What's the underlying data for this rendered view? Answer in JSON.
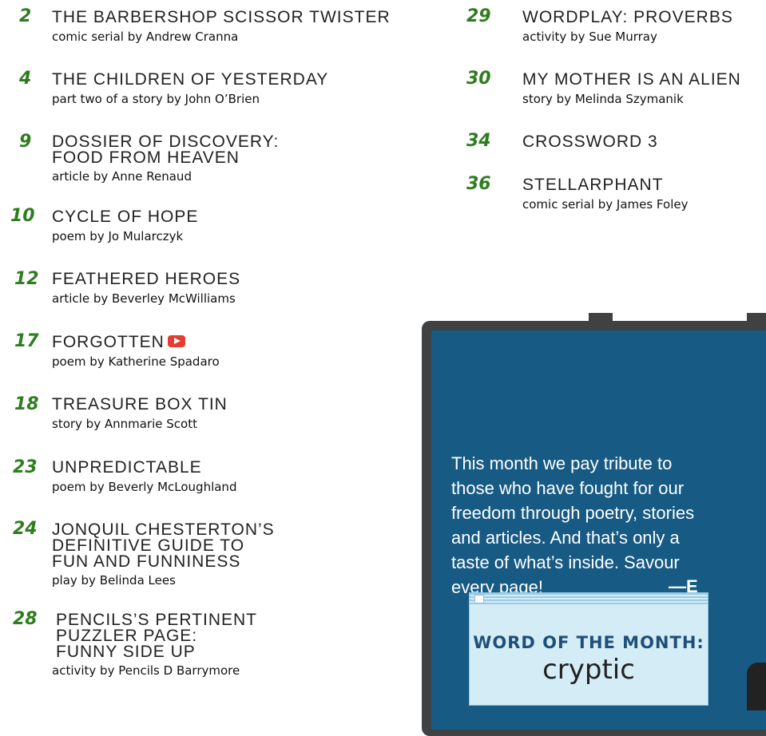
{
  "contents": [
    {
      "page": "2",
      "title": [
        "THE BARBERSHOP SCISSOR TWISTER"
      ],
      "byline": "comic serial by Andrew Cranna"
    },
    {
      "page": "4",
      "title": [
        "THE CHILDREN OF YESTERDAY"
      ],
      "byline": "part two of a story by John O’Brien"
    },
    {
      "page": "9",
      "title": [
        "DOSSIER OF DISCOVERY:",
        "FOOD FROM HEAVEN"
      ],
      "byline": "article by Anne Renaud"
    },
    {
      "page": "10",
      "title": [
        "CYCLE OF HOPE"
      ],
      "byline": "poem by Jo Mularczyk"
    },
    {
      "page": "12",
      "title": [
        "FEATHERED HEROES"
      ],
      "byline": "article by Beverley McWilliams"
    },
    {
      "page": "17",
      "title": [
        "FORGOTTEN"
      ],
      "byline": "poem by Katherine Spadaro",
      "icon": "youtube-play-icon"
    },
    {
      "page": "18",
      "title": [
        "TREASURE BOX TIN"
      ],
      "byline": "story by Annmarie Scott"
    },
    {
      "page": "23",
      "title": [
        "UNPREDICTABLE"
      ],
      "byline": "poem by Beverly McLoughland"
    },
    {
      "page": "24",
      "title": [
        "JONQUIL CHESTERTON’S",
        "DEFINITIVE GUIDE TO",
        "FUN AND FUNNINESS"
      ],
      "byline": "play by Belinda Lees"
    },
    {
      "page": "28",
      "title": [
        "PENCILS’S PERTINENT",
        "PUZZLER PAGE:",
        "FUNNY SIDE UP"
      ],
      "byline": "activity by Pencils D Barrymore"
    },
    {
      "page": "29",
      "title": [
        "WORDPLAY: PROVERBS"
      ],
      "byline": "activity by Sue Murray"
    },
    {
      "page": "30",
      "title": [
        "MY MOTHER IS AN ALIEN"
      ],
      "byline": "story by Melinda Szymanik"
    },
    {
      "page": "34",
      "title": [
        "CROSSWORD 3"
      ],
      "byline": ""
    },
    {
      "page": "36",
      "title": [
        "STELLARPHANT"
      ],
      "byline": "comic serial by James Foley"
    }
  ],
  "editorial": {
    "lines": [
      "This month we pay tribute to",
      "those who have fought for our",
      "freedom through poetry, stories",
      "and articles. And that’s only a",
      "taste of what’s inside. Savour",
      "every page!"
    ],
    "signature": "—E"
  },
  "word_of_month": {
    "heading": "WORD OF THE MONTH:",
    "word": "cryptic"
  }
}
